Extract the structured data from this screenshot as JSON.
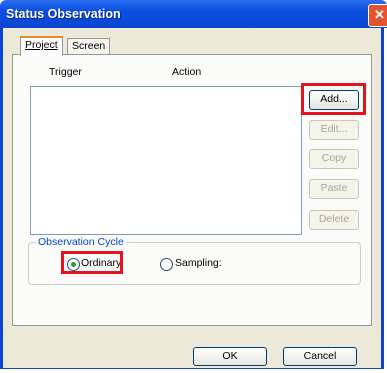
{
  "window": {
    "title": "Status Observation",
    "close_glyph": "✕"
  },
  "tabs": [
    {
      "label": "Project",
      "active": true
    },
    {
      "label": "Screen",
      "active": false
    }
  ],
  "list": {
    "columns": [
      "Trigger",
      "Action"
    ],
    "rows": []
  },
  "side_buttons": [
    {
      "label": "Add...",
      "enabled": true,
      "highlighted": true
    },
    {
      "label": "Edit...",
      "enabled": false
    },
    {
      "label": "Copy",
      "enabled": false
    },
    {
      "label": "Paste",
      "enabled": false
    },
    {
      "label": "Delete",
      "enabled": false
    }
  ],
  "observation_cycle": {
    "label": "Observation Cycle",
    "options": [
      {
        "label": "Ordinary",
        "selected": true,
        "highlighted": true
      },
      {
        "label": "Sampling:",
        "selected": false
      }
    ]
  },
  "dialog_buttons": {
    "ok": "OK",
    "cancel": "Cancel"
  },
  "colors": {
    "highlight": "#e5131e",
    "title_bar": "#0b46d0",
    "group_label": "#0046d5"
  }
}
